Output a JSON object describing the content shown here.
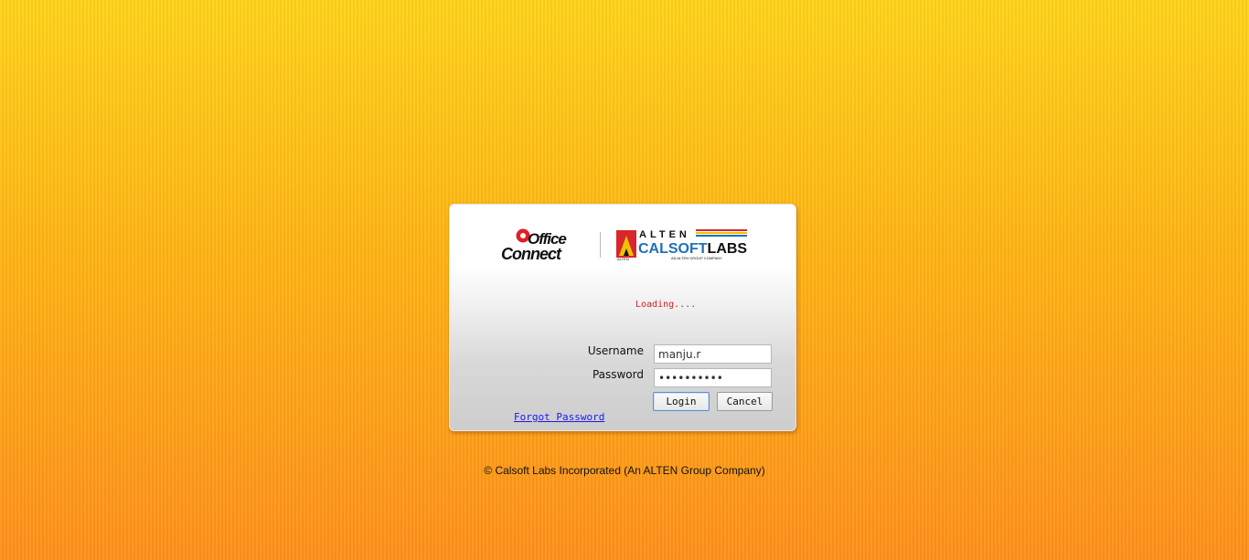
{
  "logos": {
    "office_connect": [
      "Office",
      "Connect"
    ],
    "alten": "ALTEN",
    "calsoft": "CALSOFT",
    "labs": "LABS",
    "alten_tagline": "AN ALTEN GROUP COMPANY",
    "alten_small": "ALTEN"
  },
  "login": {
    "status": "Loading....",
    "username_label": "Username",
    "username_value": "manju.r",
    "password_label": "Password",
    "password_value": "••••••••••",
    "login_button": "Login",
    "cancel_button": "Cancel",
    "forgot_link": "Forgot Password"
  },
  "footer": {
    "copyright": "© Calsoft Labs Incorporated (An ALTEN Group Company)"
  },
  "colors": {
    "status_text": "#d42020",
    "link": "#1a1aee",
    "calsoft_blue": "#1f6fb8",
    "stripe_red": "#d7262c",
    "stripe_yellow": "#f2c100",
    "stripe_blue": "#1f6fb8"
  }
}
